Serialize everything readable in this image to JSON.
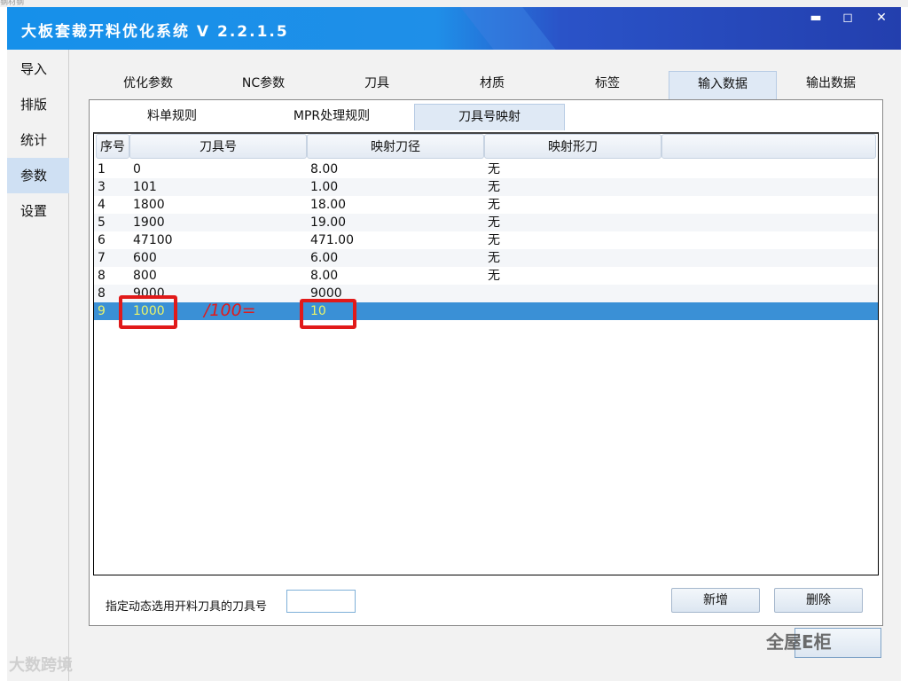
{
  "title_strip": "钢材钢",
  "window": {
    "title": "大板套裁开料优化系统 V 2.2.1.5",
    "min_glyph": "▬",
    "max_glyph": "◻",
    "close_glyph": "✕"
  },
  "sidebar": {
    "items": [
      {
        "label": "导入"
      },
      {
        "label": "排版"
      },
      {
        "label": "统计"
      },
      {
        "label": "参数",
        "active": true
      },
      {
        "label": "设置"
      }
    ]
  },
  "main_tabs": [
    {
      "label": "优化参数"
    },
    {
      "label": "NC参数"
    },
    {
      "label": "刀具"
    },
    {
      "label": "材质"
    },
    {
      "label": "标签"
    },
    {
      "label": "输入数据",
      "active": true
    },
    {
      "label": "输出数据"
    }
  ],
  "sub_tabs": [
    {
      "label": "料单规则"
    },
    {
      "label": "MPR处理规则"
    },
    {
      "label": "刀具号映射",
      "active": true
    }
  ],
  "table": {
    "columns": [
      "序号",
      "刀具号",
      "映射刀径",
      "映射形刀",
      ""
    ],
    "rows": [
      {
        "seq": "1",
        "tool": "0",
        "dia": "8.00",
        "shape": "无"
      },
      {
        "seq": "3",
        "tool": "101",
        "dia": "1.00",
        "shape": "无"
      },
      {
        "seq": "4",
        "tool": "1800",
        "dia": "18.00",
        "shape": "无"
      },
      {
        "seq": "5",
        "tool": "1900",
        "dia": "19.00",
        "shape": "无"
      },
      {
        "seq": "6",
        "tool": "47100",
        "dia": "471.00",
        "shape": "无"
      },
      {
        "seq": "7",
        "tool": "600",
        "dia": "6.00",
        "shape": "无"
      },
      {
        "seq": "8",
        "tool": "800",
        "dia": "8.00",
        "shape": "无"
      },
      {
        "seq": "8",
        "tool": "9000",
        "dia": "9000",
        "shape": ""
      },
      {
        "seq": "9",
        "tool": "1000",
        "dia": "10",
        "shape": "",
        "selected": true
      }
    ]
  },
  "annotation": {
    "text": "/100=",
    "color": "#e11a1a"
  },
  "footer": {
    "label": "指定动态选用开料刀具的刀具号",
    "input_value": "",
    "add_label": "新增",
    "delete_label": "删除"
  },
  "watermarks": {
    "left": "大数跨境",
    "right": "全屋E柜"
  },
  "colors": {
    "title_bar": "#1f8fe8",
    "selected_row": "#3a90d6",
    "selected_text": "#e9f36a",
    "highlight": "#e11a1a"
  }
}
